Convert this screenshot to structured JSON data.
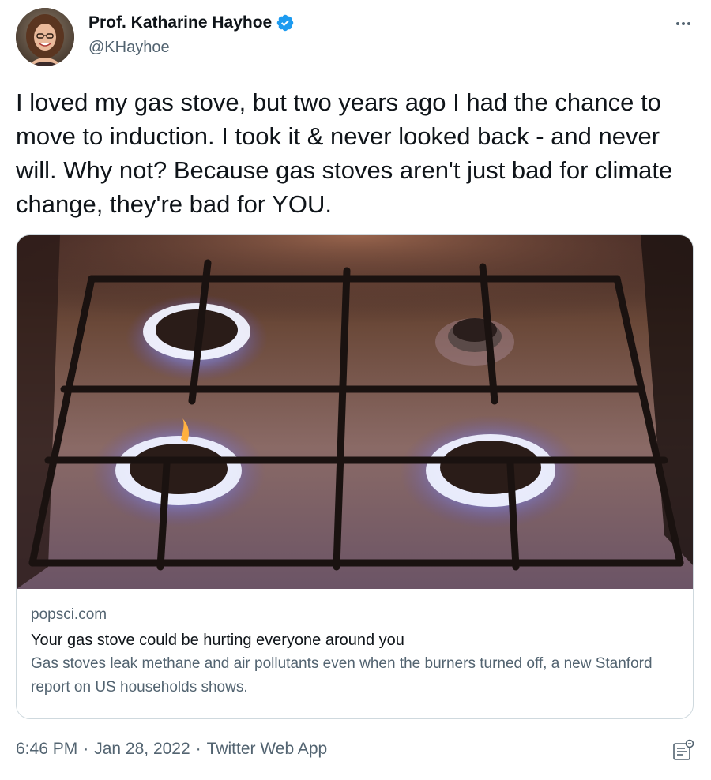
{
  "author": {
    "display_name": "Prof. Katharine Hayhoe",
    "handle": "@KHayhoe",
    "verified": true,
    "avatar_icon": "profile-photo"
  },
  "tweet": {
    "text": "I loved my gas stove, but two years ago I had the chance to move to induction. I took it & never looked back - and never will. Why not? Because gas stoves aren't just bad for climate change, they're bad for YOU."
  },
  "link_card": {
    "image_icon": "gas-stove-burners-photo",
    "domain": "popsci.com",
    "title": "Your gas stove could be hurting everyone around you",
    "description": "Gas stoves leak methane and air pollutants even when the burners turned off, a new Stanford report on US households shows."
  },
  "footer": {
    "time": "6:46 PM",
    "separator": "·",
    "date": "Jan 28, 2022",
    "source": "Twitter Web App",
    "analytics_icon": "view-tweet-analytics-icon"
  },
  "colors": {
    "text_primary": "#0f1419",
    "text_secondary": "#536471",
    "verified_blue": "#1d9bf0",
    "border": "#cfd9de"
  }
}
